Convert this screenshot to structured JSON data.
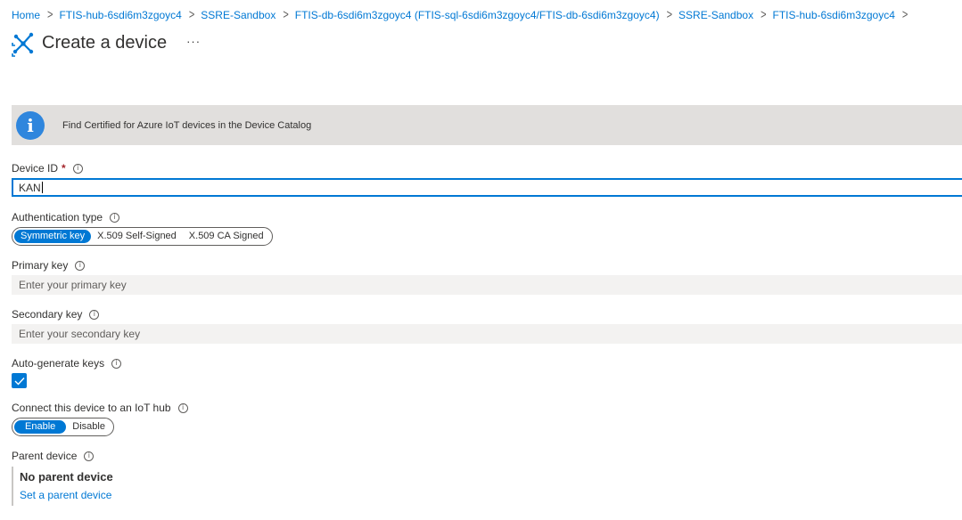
{
  "breadcrumb": [
    "Home",
    "FTIS-hub-6sdi6m3zgoyc4",
    "SSRE-Sandbox",
    "FTIS-db-6sdi6m3zgoyc4 (FTIS-sql-6sdi6m3zgoyc4/FTIS-db-6sdi6m3zgoyc4)",
    "SSRE-Sandbox",
    "FTIS-hub-6sdi6m3zgoyc4"
  ],
  "header": {
    "title": "Create a device",
    "more": "···",
    "icon": "iot-device-icon"
  },
  "info_banner": {
    "text": "Find Certified for Azure IoT devices in the Device Catalog",
    "icon": "info-icon"
  },
  "device_id": {
    "label": "Device ID",
    "required_mark": "*",
    "value": "KAN"
  },
  "auth_type": {
    "label": "Authentication type",
    "options": [
      "Symmetric key",
      "X.509 Self-Signed",
      "X.509 CA Signed"
    ],
    "selected": "Symmetric key"
  },
  "primary_key": {
    "label": "Primary key",
    "placeholder": "Enter your primary key"
  },
  "secondary_key": {
    "label": "Secondary key",
    "placeholder": "Enter your secondary key"
  },
  "auto_generate": {
    "label": "Auto-generate keys",
    "checked": true
  },
  "connect_hub": {
    "label": "Connect this device to an IoT hub",
    "options": [
      "Enable",
      "Disable"
    ],
    "selected": "Enable"
  },
  "parent_device": {
    "label": "Parent device",
    "value": "No parent device",
    "link": "Set a parent device"
  },
  "colors": {
    "accent": "#0078d4",
    "banner_bg": "#e1dfdd",
    "input_bg": "#f3f2f1"
  }
}
